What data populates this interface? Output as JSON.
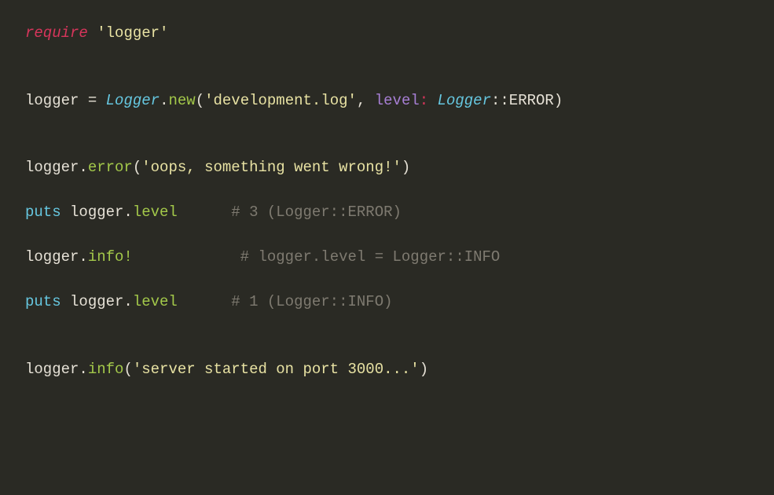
{
  "code": {
    "lines": [
      {
        "tokens": [
          {
            "cls": "tk-keyword",
            "t": "require"
          },
          {
            "cls": "tk-punct",
            "t": " "
          },
          {
            "cls": "tk-string",
            "t": "'logger'"
          }
        ]
      },
      {
        "blank": true
      },
      {
        "blank": true
      },
      {
        "tokens": [
          {
            "cls": "tk-ident",
            "t": "logger "
          },
          {
            "cls": "tk-punct",
            "t": "= "
          },
          {
            "cls": "tk-class",
            "t": "Logger"
          },
          {
            "cls": "tk-punct",
            "t": "."
          },
          {
            "cls": "tk-method",
            "t": "new"
          },
          {
            "cls": "tk-punct",
            "t": "("
          },
          {
            "cls": "tk-string",
            "t": "'development.log'"
          },
          {
            "cls": "tk-punct",
            "t": ", "
          },
          {
            "cls": "tk-param",
            "t": "level"
          },
          {
            "cls": "tk-colon",
            "t": ": "
          },
          {
            "cls": "tk-class",
            "t": "Logger"
          },
          {
            "cls": "tk-punct",
            "t": "::ERROR)"
          }
        ]
      },
      {
        "blank": true
      },
      {
        "blank": true
      },
      {
        "tokens": [
          {
            "cls": "tk-ident",
            "t": "logger."
          },
          {
            "cls": "tk-method",
            "t": "error"
          },
          {
            "cls": "tk-punct",
            "t": "("
          },
          {
            "cls": "tk-string",
            "t": "'oops, something went wrong!'"
          },
          {
            "cls": "tk-punct",
            "t": ")"
          }
        ]
      },
      {
        "blank": true
      },
      {
        "tokens": [
          {
            "cls": "tk-builtin",
            "t": "puts"
          },
          {
            "cls": "tk-ident",
            "t": " logger."
          },
          {
            "cls": "tk-method",
            "t": "level"
          },
          {
            "cls": "tk-punct",
            "t": "      "
          },
          {
            "cls": "tk-comment",
            "t": "# 3 (Logger::ERROR)"
          }
        ]
      },
      {
        "blank": true
      },
      {
        "tokens": [
          {
            "cls": "tk-ident",
            "t": "logger."
          },
          {
            "cls": "tk-method",
            "t": "info!"
          },
          {
            "cls": "tk-punct",
            "t": "            "
          },
          {
            "cls": "tk-comment",
            "t": "# logger.level = Logger::INFO"
          }
        ]
      },
      {
        "blank": true
      },
      {
        "tokens": [
          {
            "cls": "tk-builtin",
            "t": "puts"
          },
          {
            "cls": "tk-ident",
            "t": " logger."
          },
          {
            "cls": "tk-method",
            "t": "level"
          },
          {
            "cls": "tk-punct",
            "t": "      "
          },
          {
            "cls": "tk-comment",
            "t": "# 1 (Logger::INFO)"
          }
        ]
      },
      {
        "blank": true
      },
      {
        "blank": true
      },
      {
        "tokens": [
          {
            "cls": "tk-ident",
            "t": "logger."
          },
          {
            "cls": "tk-method",
            "t": "info"
          },
          {
            "cls": "tk-punct",
            "t": "("
          },
          {
            "cls": "tk-string",
            "t": "'server started on port 3000...'"
          },
          {
            "cls": "tk-punct",
            "t": ")"
          }
        ]
      }
    ]
  }
}
